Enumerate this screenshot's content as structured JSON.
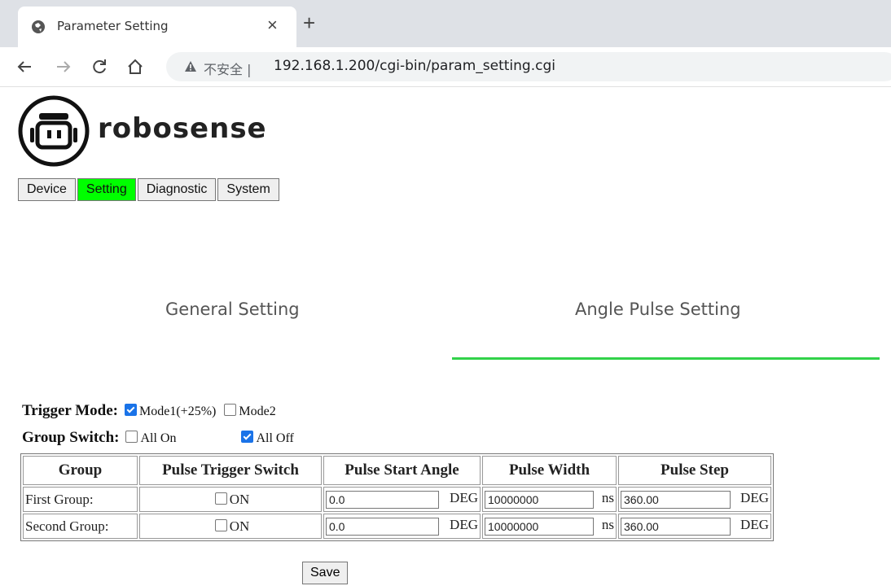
{
  "browser": {
    "tab_title": "Parameter Setting",
    "new_tab": "+",
    "close": "×",
    "insecure_label": "不安全 |",
    "url": "192.168.1.200/cgi-bin/param_setting.cgi"
  },
  "brand": {
    "name": "robosense",
    "logo": "robosense-robot-logo"
  },
  "nav": {
    "items": [
      {
        "label": "Device",
        "active": false
      },
      {
        "label": "Setting",
        "active": true
      },
      {
        "label": "Diagnostic",
        "active": false
      },
      {
        "label": "System",
        "active": false
      }
    ]
  },
  "subtabs": {
    "general": "General Setting",
    "angle_pulse": "Angle Pulse Setting",
    "active": "angle_pulse",
    "underline_color": "#32d24a"
  },
  "trigger_mode": {
    "label": "Trigger Mode:",
    "mode1": {
      "label": "Mode1(+25%)",
      "checked": true
    },
    "mode2": {
      "label": "Mode2",
      "checked": false
    }
  },
  "group_switch": {
    "label": "Group Switch:",
    "all_on": {
      "label": "All On",
      "checked": false
    },
    "all_off": {
      "label": "All Off",
      "checked": true
    }
  },
  "table": {
    "headers": [
      "Group",
      "Pulse Trigger Switch",
      "Pulse Start Angle",
      "Pulse Width",
      "Pulse Step"
    ],
    "rows": [
      {
        "group": "First Group:",
        "switch_label": "ON",
        "switch_checked": false,
        "start_angle": "0.0",
        "start_unit": "DEG",
        "width": "10000000",
        "width_unit": "ns",
        "step": "360.00",
        "step_unit": "DEG"
      },
      {
        "group": "Second Group:",
        "switch_label": "ON",
        "switch_checked": false,
        "start_angle": "0.0",
        "start_unit": "DEG",
        "width": "10000000",
        "width_unit": "ns",
        "step": "360.00",
        "step_unit": "DEG"
      }
    ]
  },
  "save_label": "Save",
  "colors": {
    "active_nav": "#00ff00",
    "checkbox": "#1a73e8"
  }
}
